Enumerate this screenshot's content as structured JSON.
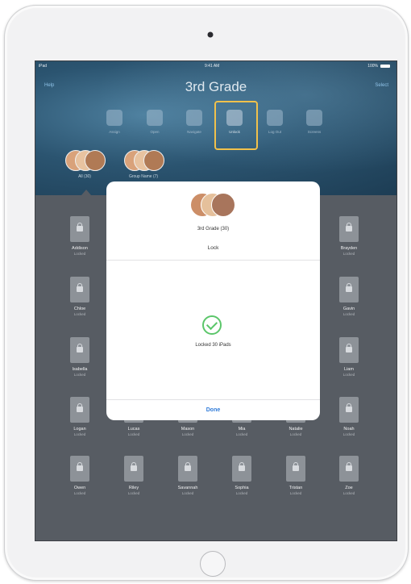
{
  "status_bar": {
    "carrier": "iPad",
    "time": "9:41 AM",
    "battery": "100%"
  },
  "header": {
    "left_link": "Help",
    "title": "3rd Grade",
    "right_link": "Select"
  },
  "toolbar": [
    {
      "label": "Assign",
      "icon": "assign-icon"
    },
    {
      "label": "Open",
      "icon": "open-icon"
    },
    {
      "label": "Navigate",
      "icon": "navigate-icon"
    },
    {
      "label": "Unlock",
      "icon": "lock-icon",
      "highlighted": true
    },
    {
      "label": "Log Out",
      "icon": "logout-icon"
    },
    {
      "label": "Screens",
      "icon": "screens-icon"
    }
  ],
  "groups": [
    {
      "label": "All (30)"
    },
    {
      "label": "Group Name (7)"
    }
  ],
  "students": [
    {
      "name": "Addison",
      "status": "Locked"
    },
    {
      "name": "Brayden",
      "status": "Locked"
    },
    {
      "name": "Chloe",
      "status": "Locked"
    },
    {
      "name": "Gavin",
      "status": "Locked"
    },
    {
      "name": "Isabella",
      "status": "Locked"
    },
    {
      "name": "Liam",
      "status": "Locked"
    },
    {
      "name": "Logan",
      "status": "Locked"
    },
    {
      "name": "Lucas",
      "status": "Locked"
    },
    {
      "name": "Mason",
      "status": "Locked"
    },
    {
      "name": "Mia",
      "status": "Locked"
    },
    {
      "name": "Natalie",
      "status": "Locked"
    },
    {
      "name": "Noah",
      "status": "Locked"
    },
    {
      "name": "Owen",
      "status": "Locked"
    },
    {
      "name": "Riley",
      "status": "Locked"
    },
    {
      "name": "Savannah",
      "status": "Locked"
    },
    {
      "name": "Sophia",
      "status": "Locked"
    },
    {
      "name": "Tristan",
      "status": "Locked"
    },
    {
      "name": "Zoe",
      "status": "Locked"
    }
  ],
  "modal": {
    "class_name": "3rd Grade (30)",
    "action": "Lock",
    "result": "Locked 30 iPads",
    "done_label": "Done"
  },
  "colors": {
    "highlight": "#f1c14b",
    "success": "#5bc66a",
    "link": "#2f7bd9"
  }
}
